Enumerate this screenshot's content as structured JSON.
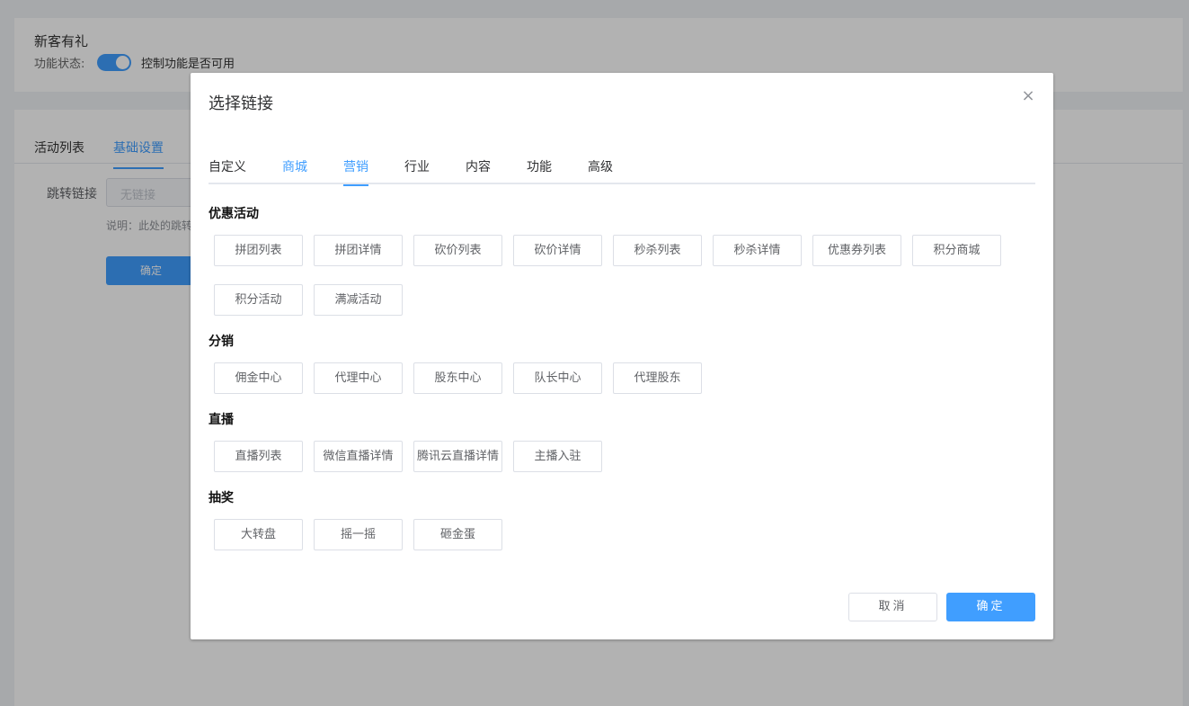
{
  "background": {
    "card_title": "新客有礼",
    "status_label": "功能状态:",
    "switch_desc": "控制功能是否可用",
    "tabs": [
      "活动列表",
      "基础设置"
    ],
    "jump_label": "跳转链接",
    "jump_placeholder": "无链接",
    "note": "说明：此处的跳转",
    "confirm_label": "确定"
  },
  "dialog": {
    "title": "选择链接",
    "close_glyph": "×",
    "tabs": [
      {
        "label": "自定义"
      },
      {
        "label": "商城"
      },
      {
        "label": "营销"
      },
      {
        "label": "行业"
      },
      {
        "label": "内容"
      },
      {
        "label": "功能"
      },
      {
        "label": "高级"
      }
    ],
    "active_tab": "营销",
    "sections": [
      {
        "title": "优惠活动",
        "items": [
          "拼团列表",
          "拼团详情",
          "砍价列表",
          "砍价详情",
          "秒杀列表",
          "秒杀详情",
          "优惠券列表",
          "积分商城",
          "积分活动",
          "满减活动"
        ]
      },
      {
        "title": "分销",
        "items": [
          "佣金中心",
          "代理中心",
          "股东中心",
          "队长中心",
          "代理股东"
        ]
      },
      {
        "title": "直播",
        "items": [
          "直播列表",
          "微信直播详情",
          "腾讯云直播详情",
          "主播入驻"
        ]
      },
      {
        "title": "抽奖",
        "items": [
          "大转盘",
          "摇一摇",
          "砸金蛋"
        ]
      }
    ],
    "cancel_label": "取消",
    "ok_label": "确定"
  },
  "colors": {
    "accent": "#409eff",
    "overlay": "rgba(0,0,0,0.3)"
  }
}
